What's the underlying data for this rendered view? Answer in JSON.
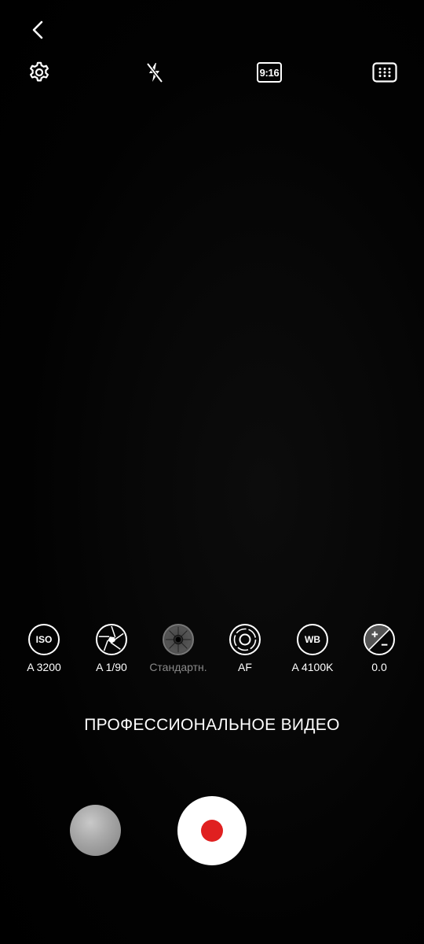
{
  "top_bar": {
    "back_icon": "chevron-left-icon",
    "settings_icon": "gear-icon",
    "flash_icon": "flash-off-icon",
    "aspect_ratio_label": "9:16",
    "grid_icon": "grid-dots-icon"
  },
  "pro_controls": [
    {
      "id": "iso",
      "icon_text": "ISO",
      "label": "A 3200"
    },
    {
      "id": "shutter",
      "icon_text": "",
      "label": "A 1/90"
    },
    {
      "id": "metering",
      "icon_text": "",
      "label": "Стандартн."
    },
    {
      "id": "focus",
      "icon_text": "",
      "label": "AF"
    },
    {
      "id": "white-balance",
      "icon_text": "WB",
      "label": "A 4100K"
    },
    {
      "id": "exposure",
      "icon_text": "",
      "label": "0.0"
    }
  ],
  "mode_title": "ПРОФЕССИОНАЛЬНОЕ ВИДЕО",
  "colors": {
    "background": "#000000",
    "record_dot": "#e02020",
    "record_button": "#ffffff",
    "dim_label": "#8a8a8a"
  }
}
